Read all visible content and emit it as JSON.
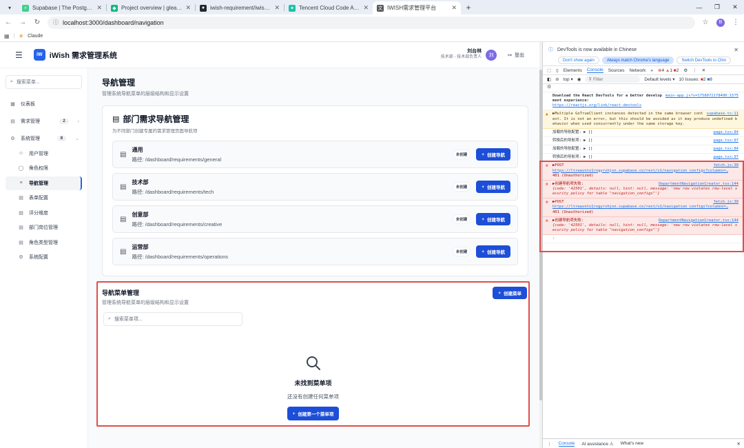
{
  "browser": {
    "tabs": [
      {
        "title": "Supabase | The Postgres Dev",
        "color": "#3ecf8e",
        "glyph": "⚡"
      },
      {
        "title": "Project overview | gleaming",
        "color": "#10b981",
        "glyph": "◆"
      },
      {
        "title": "iwish-requirement/iwish-req",
        "color": "#24292f",
        "glyph": "●"
      },
      {
        "title": "Tencent Cloud Code Assistar",
        "color": "#19c3a7",
        "glyph": "✦"
      },
      {
        "title": "IWISH需求管理平台",
        "color": "#555555",
        "glyph": "文"
      }
    ],
    "active_tab": 4,
    "url": "localhost:3000/dashboard/navigation",
    "bookmark": "Claude",
    "profile_initial": "B"
  },
  "app": {
    "logo": "iW",
    "title": "iWish 需求管理系统",
    "user": {
      "name": "刘台林",
      "dept": "技术部 - 技术部负责人",
      "avatar": "刘"
    },
    "logout": "登出"
  },
  "sidebar": {
    "search_placeholder": "搜索菜单...",
    "items": [
      {
        "label": "仪表板",
        "icon": "▦"
      },
      {
        "label": "需求管理",
        "icon": "▤",
        "badge": "2"
      },
      {
        "label": "系统管理",
        "icon": "⚙",
        "badge": "8"
      },
      {
        "label": "用户管理",
        "icon": "☺"
      },
      {
        "label": "角色权限",
        "icon": "◯"
      },
      {
        "label": "导航管理",
        "icon": "≡"
      },
      {
        "label": "表单配置",
        "icon": "▤"
      },
      {
        "label": "评分维度",
        "icon": "▤"
      },
      {
        "label": "部门岗位管理",
        "icon": "▤"
      },
      {
        "label": "角色类型管理",
        "icon": "▤"
      },
      {
        "label": "系统配置",
        "icon": "⚙"
      }
    ]
  },
  "page": {
    "title": "导航管理",
    "subtitle": "管理系统导航菜单的层级结构和显示设置"
  },
  "dept_card": {
    "title": "部门需求导航管理",
    "subtitle": "为不同部门创建专属的需求管理页面导航项",
    "tag": "未创建",
    "create_label": "创建导航",
    "path_prefix": "路径: ",
    "depts": [
      {
        "name": "通用",
        "path": "/dashboard/requirements/general"
      },
      {
        "name": "技术部",
        "path": "/dashboard/requirements/tech"
      },
      {
        "name": "创意部",
        "path": "/dashboard/requirements/creative"
      },
      {
        "name": "运营部",
        "path": "/dashboard/requirements/operations"
      }
    ]
  },
  "menu_card": {
    "title": "导航菜单管理",
    "subtitle": "管理系统导航菜单的层级结构和显示设置",
    "create_label": "创建菜单",
    "search_placeholder": "搜索菜单项...",
    "empty_title": "未找到菜单项",
    "empty_sub": "还没有创建任何菜单项",
    "empty_button": "创建第一个菜单项"
  },
  "devtools": {
    "banner": "DevTools is now available in Chinese",
    "banner_btns": [
      "Don't show again",
      "Always match Chrome's language",
      "Switch DevTools to Chin"
    ],
    "tabs": [
      "Elements",
      "Console",
      "Sources",
      "Network",
      "»"
    ],
    "active_tab": "Console",
    "err_count": "4",
    "warn_count": "1",
    "info_count": "2",
    "context": "top ▾",
    "filter": "Filter",
    "levels": "Default levels ▾",
    "issues": "10 Issues:",
    "issues_err": "2",
    "issues_info": "8",
    "drawer": [
      "Console",
      "AI assistance ⚠",
      "What's new"
    ],
    "logs": [
      {
        "type": "info",
        "src": "main-app.js?v=1758072178400:1575",
        "text": "",
        "rich": "react"
      },
      {
        "type": "warn",
        "src": "supabase.ts:11",
        "text": "▶Multiple GoTrueClient instances detected in the same browser context. It is not an error, but this should be avoided as it may produce undefined behavior when used concurrently under the same storage key."
      },
      {
        "type": "info",
        "src": "page.tsx:84",
        "text": "加载的导航配置: ▶ []"
      },
      {
        "type": "info",
        "src": "page.tsx:97",
        "text": "转换后的导航项: ▶ []"
      },
      {
        "type": "info",
        "src": "page.tsx:84",
        "text": "加载的导航配置: ▶ []"
      },
      {
        "type": "info",
        "src": "page.tsx:97",
        "text": "转换后的导航项: ▶ []"
      },
      {
        "type": "err",
        "src": "fetch.js:30",
        "text": "▶POST",
        "url": "https://ltrewvnto1rogyrvhjon.supabase.co/rest/v1/navigation_configs?columns=…",
        "after": "401 (Unauthorized)"
      },
      {
        "type": "err",
        "src": "DepartmentNavigationCreator.tsx:144",
        "text": "▶创建导航项失败:",
        "detail": "{code: '42501', details: null, hint: null, message: 'new row violates row-level security policy for table \"navigation_configs\"'}"
      },
      {
        "type": "err",
        "src": "fetch.js:30",
        "text": "▶POST",
        "url": "https://ltrewvnto1rogyrvhjon.supabase.co/rest/v1/navigation_configs?columns=…",
        "after": "401 (Unauthorized)"
      },
      {
        "type": "err",
        "src": "DepartmentNavigationCreator.tsx:144",
        "text": "▶创建导航项失败:",
        "detail": "{code: '42501', details: null, hint: null, message: 'new row violates row-level security policy for table \"navigation_configs\"'}"
      }
    ],
    "react_msg": "Download the React DevTools for a better development experience:",
    "react_link": "https://reactjs.org/link/react-devtools"
  }
}
